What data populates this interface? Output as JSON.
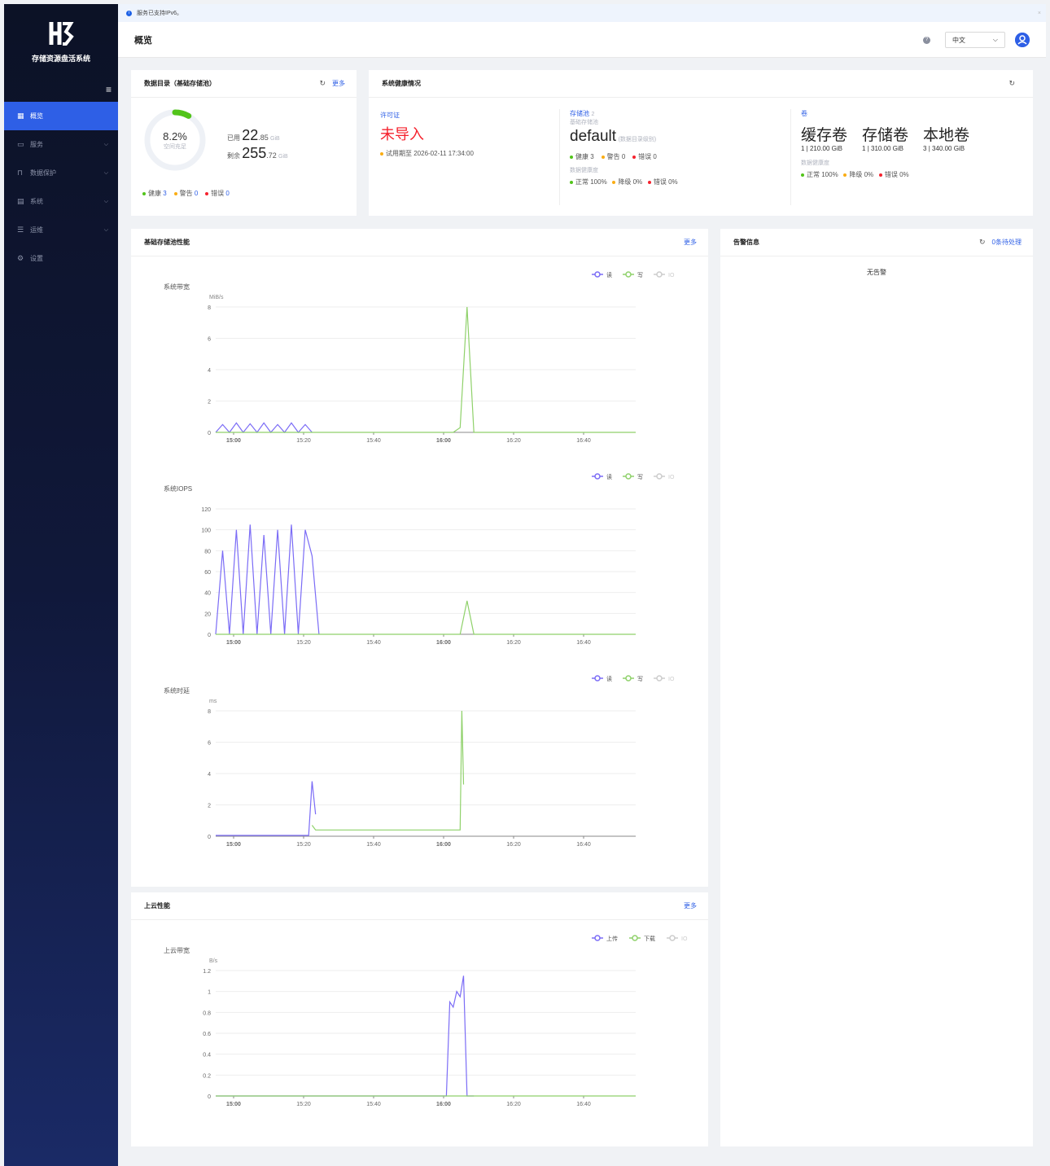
{
  "app": {
    "name": "存储资源盘活系统"
  },
  "sidebar": {
    "items": [
      {
        "label": "概览",
        "icon": "grid-icon",
        "active": true
      },
      {
        "label": "服务",
        "icon": "box-icon",
        "has_children": true
      },
      {
        "label": "数据保护",
        "icon": "lock-icon",
        "has_children": true
      },
      {
        "label": "系统",
        "icon": "table-icon",
        "has_children": true
      },
      {
        "label": "运维",
        "icon": "list-icon",
        "has_children": true
      },
      {
        "label": "设置",
        "icon": "gear-icon"
      }
    ]
  },
  "banner": {
    "text": "服务已支持IPv6。"
  },
  "header": {
    "title": "概览",
    "language": "中文"
  },
  "catalog": {
    "title": "数据目录（基础存储池）",
    "more": "更多",
    "percent": "8.2%",
    "percent_label": "空间充足",
    "usage_fraction": 0.082,
    "used_label": "已用",
    "used_int": "22",
    "used_dec": ".85",
    "used_unit": "GiB",
    "free_label": "剩余",
    "free_int": "255",
    "free_dec": ".72",
    "free_unit": "GiB",
    "status": {
      "healthy_label": "健康",
      "healthy": "3",
      "warn_label": "警告",
      "warn": "0",
      "error_label": "错误",
      "error": "0"
    }
  },
  "health": {
    "title": "系统健康情况",
    "license": {
      "label": "许可证",
      "value": "未导入",
      "trial": "试用期至 2026-02-11 17:34:00"
    },
    "pool": {
      "label": "存储池",
      "count": "2",
      "sublabel": "基础存储池",
      "name": "default",
      "name_note": "(数据目录级别)",
      "healthy_label": "健康",
      "healthy": "3",
      "warn_label": "警告",
      "warn": "0",
      "error_label": "错误",
      "error": "0",
      "data_health_label": "数据健康度",
      "normal_label": "正常",
      "normal": "100%",
      "degraded_label": "降级",
      "degraded": "0%",
      "err_label": "错误",
      "err": "0%"
    },
    "volumes": {
      "label": "卷",
      "types": [
        {
          "name": "缓存卷",
          "detail": "1 | 210.00 GiB"
        },
        {
          "name": "存储卷",
          "detail": "1 | 310.00 GiB"
        },
        {
          "name": "本地卷",
          "detail": "3 | 340.00 GiB"
        }
      ],
      "data_health_label": "数据健康度",
      "normal_label": "正常",
      "normal": "100%",
      "degraded_label": "降级",
      "degraded": "0%",
      "err_label": "错误",
      "err": "0%"
    }
  },
  "perf": {
    "title": "基础存储池性能",
    "more": "更多"
  },
  "alerts": {
    "title": "告警信息",
    "pending": "0条待处理",
    "empty": "无告警"
  },
  "cloud": {
    "title": "上云性能",
    "more": "更多"
  },
  "colors": {
    "read": "#7b6cf6",
    "write": "#8fd16a",
    "other": "#cccccc",
    "accent": "#2e5fe6"
  },
  "chart_data": [
    {
      "type": "line",
      "title": "系统带宽",
      "ylabel": "MiB/s",
      "ylim": [
        0,
        8
      ],
      "yticks": [
        "0",
        "2",
        "4",
        "6",
        "8"
      ],
      "xticks": [
        "15:00",
        "15:20",
        "15:40",
        "16:00",
        "16:20",
        "16:40"
      ],
      "legend": [
        "读",
        "写",
        "IO"
      ],
      "series": [
        {
          "name": "读",
          "x": [
            14.93,
            14.95,
            14.97,
            14.99,
            15.01,
            15.03,
            15.05,
            15.07,
            15.09,
            15.11,
            15.13,
            15.15,
            15.17,
            15.19,
            15.21
          ],
          "values": [
            0,
            0.5,
            0,
            0.6,
            0,
            0.55,
            0,
            0.6,
            0,
            0.5,
            0,
            0.6,
            0,
            0.5,
            0
          ]
        },
        {
          "name": "写",
          "x": [
            14.93,
            15.45,
            15.62,
            15.64,
            15.66,
            15.68,
            16.15
          ],
          "values": [
            0,
            0,
            0,
            0.3,
            8,
            0,
            0
          ]
        }
      ]
    },
    {
      "type": "line",
      "title": "系统IOPS",
      "ylim": [
        0,
        120
      ],
      "yticks": [
        "0",
        "20",
        "40",
        "60",
        "80",
        "100",
        "120"
      ],
      "xticks": [
        "15:00",
        "15:20",
        "15:40",
        "16:00",
        "16:20",
        "16:40"
      ],
      "legend": [
        "读",
        "写",
        "IO"
      ],
      "series": [
        {
          "name": "读",
          "x": [
            14.93,
            14.95,
            14.97,
            14.99,
            15.01,
            15.03,
            15.05,
            15.07,
            15.09,
            15.11,
            15.13,
            15.15,
            15.17,
            15.19,
            15.21,
            15.23
          ],
          "values": [
            0,
            80,
            0,
            100,
            0,
            105,
            0,
            95,
            0,
            100,
            0,
            105,
            0,
            100,
            75,
            0
          ]
        },
        {
          "name": "写",
          "x": [
            14.93,
            15.62,
            15.64,
            15.66,
            15.68,
            16.15
          ],
          "values": [
            0,
            0,
            0,
            32,
            0,
            0
          ]
        }
      ]
    },
    {
      "type": "line",
      "title": "系统时延",
      "ylabel": "ms",
      "ylim": [
        0,
        8
      ],
      "yticks": [
        "0",
        "2",
        "4",
        "6",
        "8"
      ],
      "xticks": [
        "15:00",
        "15:20",
        "15:40",
        "16:00",
        "16:20",
        "16:40"
      ],
      "legend": [
        "读",
        "写",
        "IO"
      ],
      "series": [
        {
          "name": "读",
          "x": [
            14.93,
            15.2,
            15.21,
            15.22
          ],
          "values": [
            0.05,
            0.05,
            3.5,
            1.4
          ]
        },
        {
          "name": "写",
          "x": [
            15.21,
            15.22,
            15.63,
            15.64,
            15.645,
            15.65
          ],
          "values": [
            0.7,
            0.4,
            0.4,
            0.4,
            8,
            3.3
          ]
        }
      ]
    },
    {
      "type": "line",
      "title": "上云带宽",
      "ylabel": "B/s",
      "ylim": [
        0,
        1.2
      ],
      "yticks": [
        "0",
        "0.2",
        "0.4",
        "0.6",
        "0.8",
        "1",
        "1.2"
      ],
      "xticks": [
        "15:00",
        "15:20",
        "15:40",
        "16:00",
        "16:20",
        "16:40"
      ],
      "legend": [
        "上传",
        "下载",
        "IO"
      ],
      "series": [
        {
          "name": "上传",
          "x": [
            14.93,
            15.6,
            15.61,
            15.62,
            15.63,
            15.64,
            15.65,
            15.66,
            15.67,
            15.68
          ],
          "values": [
            0,
            0,
            0.9,
            0.85,
            1.0,
            0.95,
            1.15,
            0,
            0,
            0
          ]
        },
        {
          "name": "下载",
          "x": [
            14.93,
            16.15
          ],
          "values": [
            0,
            0
          ]
        }
      ]
    }
  ]
}
